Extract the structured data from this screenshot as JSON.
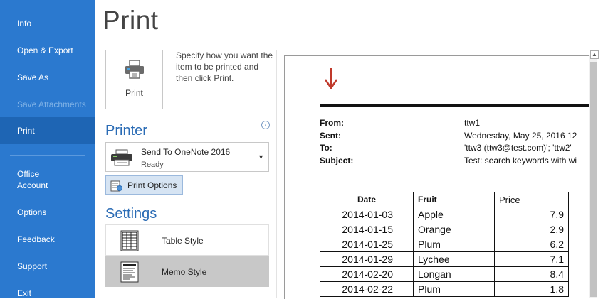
{
  "nav": {
    "items": [
      {
        "label": "Info",
        "state": "normal"
      },
      {
        "label": "Open & Export",
        "state": "normal"
      },
      {
        "label": "Save As",
        "state": "normal"
      },
      {
        "label": "Save Attachments",
        "state": "disabled"
      },
      {
        "label": "Print",
        "state": "selected"
      },
      {
        "label": "Office\nAccount",
        "state": "normal"
      },
      {
        "label": "Options",
        "state": "normal"
      },
      {
        "label": "Feedback",
        "state": "normal"
      },
      {
        "label": "Support",
        "state": "normal"
      },
      {
        "label": "Exit",
        "state": "normal"
      }
    ]
  },
  "page": {
    "title": "Print"
  },
  "print_button": {
    "label": "Print",
    "icon": "printer-icon",
    "description": "Specify how you want the item to be printed and then click Print."
  },
  "printer": {
    "heading": "Printer",
    "name": "Send To OneNote 2016",
    "status": "Ready",
    "options_label": "Print Options"
  },
  "settings": {
    "heading": "Settings",
    "styles": [
      {
        "label": "Table Style",
        "icon": "table-style-icon",
        "selected": false
      },
      {
        "label": "Memo Style",
        "icon": "memo-style-icon",
        "selected": true
      }
    ]
  },
  "preview": {
    "header": [
      {
        "label": "From:",
        "value": "ttw1"
      },
      {
        "label": "Sent:",
        "value": "Wednesday, May 25, 2016 12"
      },
      {
        "label": "To:",
        "value": "'ttw3 (ttw3@test.com)'; 'ttw2'"
      },
      {
        "label": "Subject:",
        "value": "Test: search keywords with wi"
      }
    ],
    "table": {
      "columns": [
        "Date",
        "Fruit",
        "Price"
      ],
      "rows": [
        [
          "2014-01-03",
          "Apple",
          "7.9"
        ],
        [
          "2014-01-15",
          "Orange",
          "2.9"
        ],
        [
          "2014-01-25",
          "Plum",
          "6.2"
        ],
        [
          "2014-01-29",
          "Lychee",
          "7.1"
        ],
        [
          "2014-02-20",
          "Longan",
          "8.4"
        ],
        [
          "2014-02-22",
          "Plum",
          "1.8"
        ]
      ]
    }
  },
  "colors": {
    "nav_bg": "#2b79cf",
    "nav_selected": "#1e65b4",
    "heading_blue": "#2b6cb5",
    "arrow_red": "#c0392b"
  }
}
